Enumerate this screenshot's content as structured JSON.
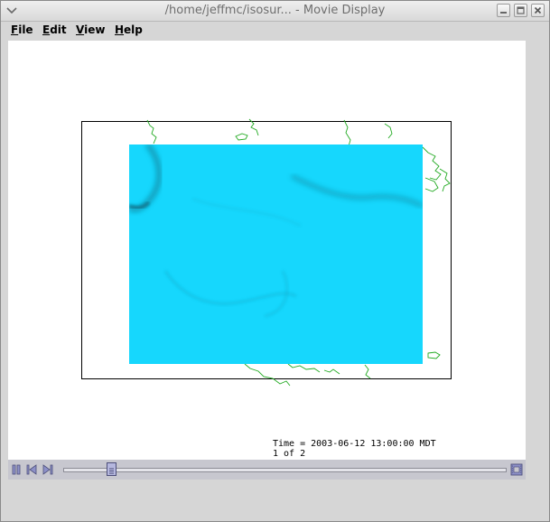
{
  "window": {
    "title": "/home/jeffmc/isosur...  - Movie Display"
  },
  "menubar": {
    "items": [
      {
        "label": "File"
      },
      {
        "label": "Edit"
      },
      {
        "label": "View"
      },
      {
        "label": "Help"
      }
    ]
  },
  "display": {
    "time_text": "Time = 2003-06-12 13:00:00 MDT",
    "frame_text": "1 of 2",
    "isosurface_color": "#16d7fd",
    "coastline_color": "#22aa22"
  },
  "animation": {
    "current_frame": 1,
    "total_frames": 2,
    "buttons": [
      "pause-icon",
      "step-back-icon",
      "step-forward-icon",
      "film-icon"
    ]
  }
}
